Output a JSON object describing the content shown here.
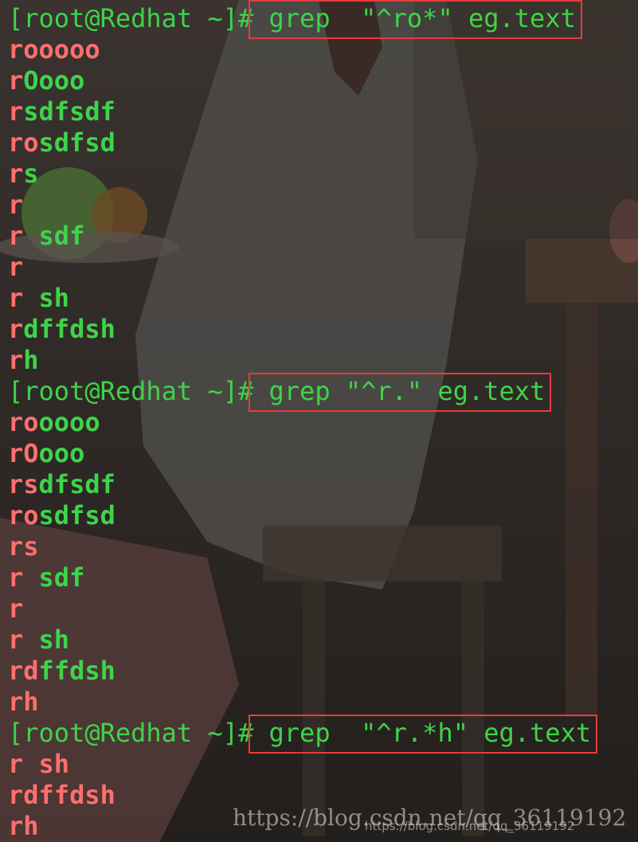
{
  "terminal": {
    "blocks": [
      {
        "prompt": "[root@Redhat ~]#",
        "command": " grep  \"^ro*\" eg.text",
        "output": [
          {
            "hl": "rooooo",
            "rest": ""
          },
          {
            "hl": "r",
            "rest": "Oooo"
          },
          {
            "hl": "r",
            "rest": "sdfsdf"
          },
          {
            "hl": "ro",
            "rest": "sdfsd"
          },
          {
            "hl": "r",
            "rest": "s"
          },
          {
            "hl": "r",
            "rest": ""
          },
          {
            "hl": "r",
            "rest": " sdf"
          },
          {
            "hl": "r",
            "rest": ""
          },
          {
            "hl": "r",
            "rest": " sh"
          },
          {
            "hl": "r",
            "rest": "dffdsh"
          },
          {
            "hl": "r",
            "rest": "h"
          }
        ]
      },
      {
        "prompt": "[root@Redhat ~]#",
        "command": " grep \"^r.\" eg.text",
        "output": [
          {
            "hl": "ro",
            "rest": "oooo"
          },
          {
            "hl": "rO",
            "rest": "ooo"
          },
          {
            "hl": "rs",
            "rest": "dfsdf"
          },
          {
            "hl": "ro",
            "rest": "sdfsd"
          },
          {
            "hl": "rs",
            "rest": ""
          },
          {
            "hl": "r ",
            "rest": "sdf"
          },
          {
            "hl": "r",
            "rest": ""
          },
          {
            "hl": "r ",
            "rest": "sh"
          },
          {
            "hl": "rd",
            "rest": "ffdsh"
          },
          {
            "hl": "rh",
            "rest": ""
          }
        ]
      },
      {
        "prompt": "[root@Redhat ~]#",
        "command": " grep  \"^r.*h\" eg.text",
        "output": [
          {
            "hl": "r sh",
            "rest": ""
          },
          {
            "hl": "rdffdsh",
            "rest": ""
          },
          {
            "hl": "rh",
            "rest": ""
          }
        ]
      }
    ]
  },
  "watermark": {
    "large": "https://blog.csdn.net/qq_36119192",
    "small": "https://blog.csdn.net/qq_36119192"
  },
  "colors": {
    "prompt_text": "#3ed44a",
    "match_highlight": "#ff6f6f",
    "annotation_box": "#ea3a3a",
    "background": "#2b2622"
  }
}
